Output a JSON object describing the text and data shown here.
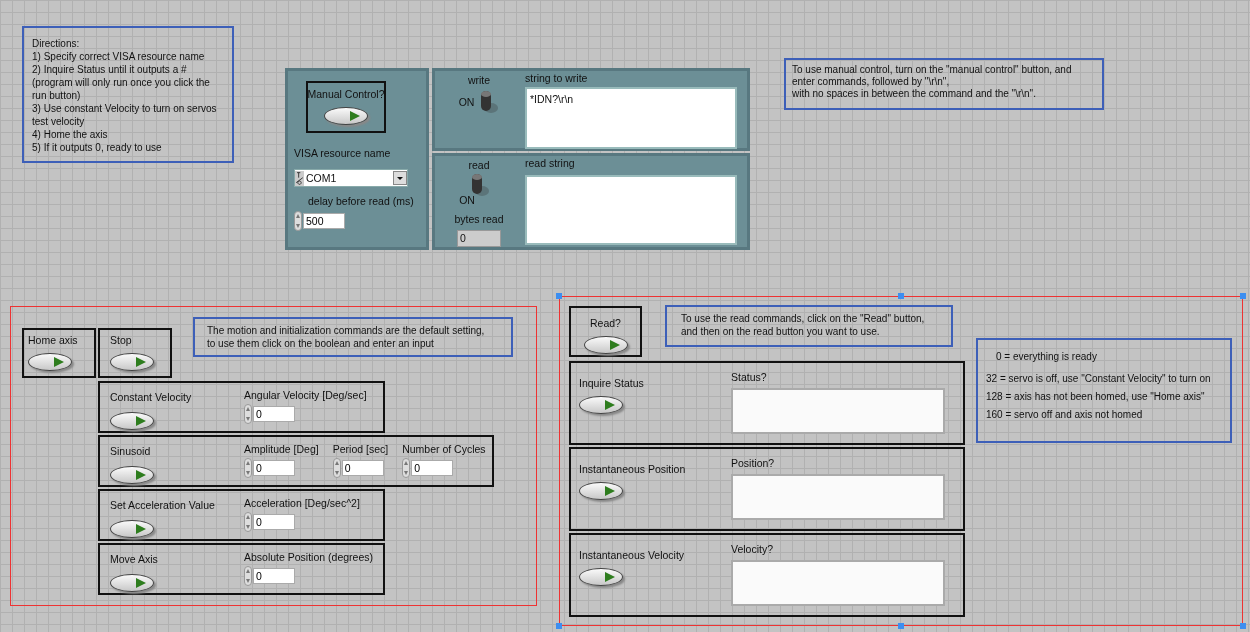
{
  "directions": {
    "lines": [
      "Directions:",
      "1) Specify correct VISA resource name",
      "2) Inquire Status until it outputs a #",
      "(program will only run once you click the",
      "run button)",
      "3) Use constant Velocity to turn on servos",
      "test velocity",
      "4) Home the axis",
      "5) If it outputs 0, ready to use"
    ]
  },
  "manual_panel": {
    "manual_control": {
      "label": "Manual Control?"
    },
    "visa": {
      "label": "VISA resource name",
      "value": "COM1"
    },
    "delay": {
      "label": "delay before read (ms)",
      "value": "500"
    }
  },
  "write_panel": {
    "switch_label": "write",
    "on_label": "ON",
    "on": true,
    "string": {
      "label": "string to write",
      "value": "*IDN?\\r\\n"
    }
  },
  "read_panel": {
    "switch_label": "read",
    "on_label": "ON",
    "on": true,
    "bytes_read": {
      "label": "bytes read",
      "value": "0"
    },
    "string": {
      "label": "read string"
    }
  },
  "manual_note": {
    "lines": [
      "To use manual control, turn on the \"manual control\" button, and",
      "enter commands, followed by \"\\r\\n\",",
      "with no spaces in between the command and the \"\\r\\n\"."
    ]
  },
  "motion": {
    "buttons": [
      {
        "label": "Home axis"
      },
      {
        "label": "Stop"
      }
    ],
    "note": {
      "lines": [
        "The motion and initialization commands are the default setting,",
        "to use them click on the boolean and enter an input"
      ]
    },
    "commands": [
      {
        "label": "Constant Velocity",
        "inputs": [
          {
            "label": "Angular Velocity [Deg/sec]",
            "value": "0"
          }
        ]
      },
      {
        "label": "Sinusoid",
        "inputs": [
          {
            "label": "Amplitude [Deg]",
            "value": "0"
          },
          {
            "label": "Period [sec]",
            "value": "0"
          },
          {
            "label": "Number of Cycles",
            "value": "0"
          }
        ]
      },
      {
        "label": "Set Acceleration Value",
        "inputs": [
          {
            "label": "Acceleration [Deg/sec^2]",
            "value": "0"
          }
        ]
      },
      {
        "label": "Move Axis",
        "inputs": [
          {
            "label": "Absolute Position (degrees)",
            "value": "0"
          }
        ]
      }
    ]
  },
  "read_section": {
    "read_button": {
      "label": "Read?"
    },
    "note": {
      "lines": [
        "To use the read commands, click on the \"Read\" button,",
        "and then on the read button you want to use."
      ]
    },
    "queries": [
      {
        "label": "Inquire Status",
        "indicator": "Status?"
      },
      {
        "label": "Instantaneous Position",
        "indicator": "Position?"
      },
      {
        "label": "Instantaneous Velocity",
        "indicator": "Velocity?"
      }
    ]
  },
  "status_codes": {
    "lines": [
      "0 = everything is ready",
      "32 = servo is off, use \"Constant Velocity\" to turn on",
      "128 = axis has not been homed, use \"Home axis\"",
      "160 = servo off and axis not homed"
    ]
  }
}
